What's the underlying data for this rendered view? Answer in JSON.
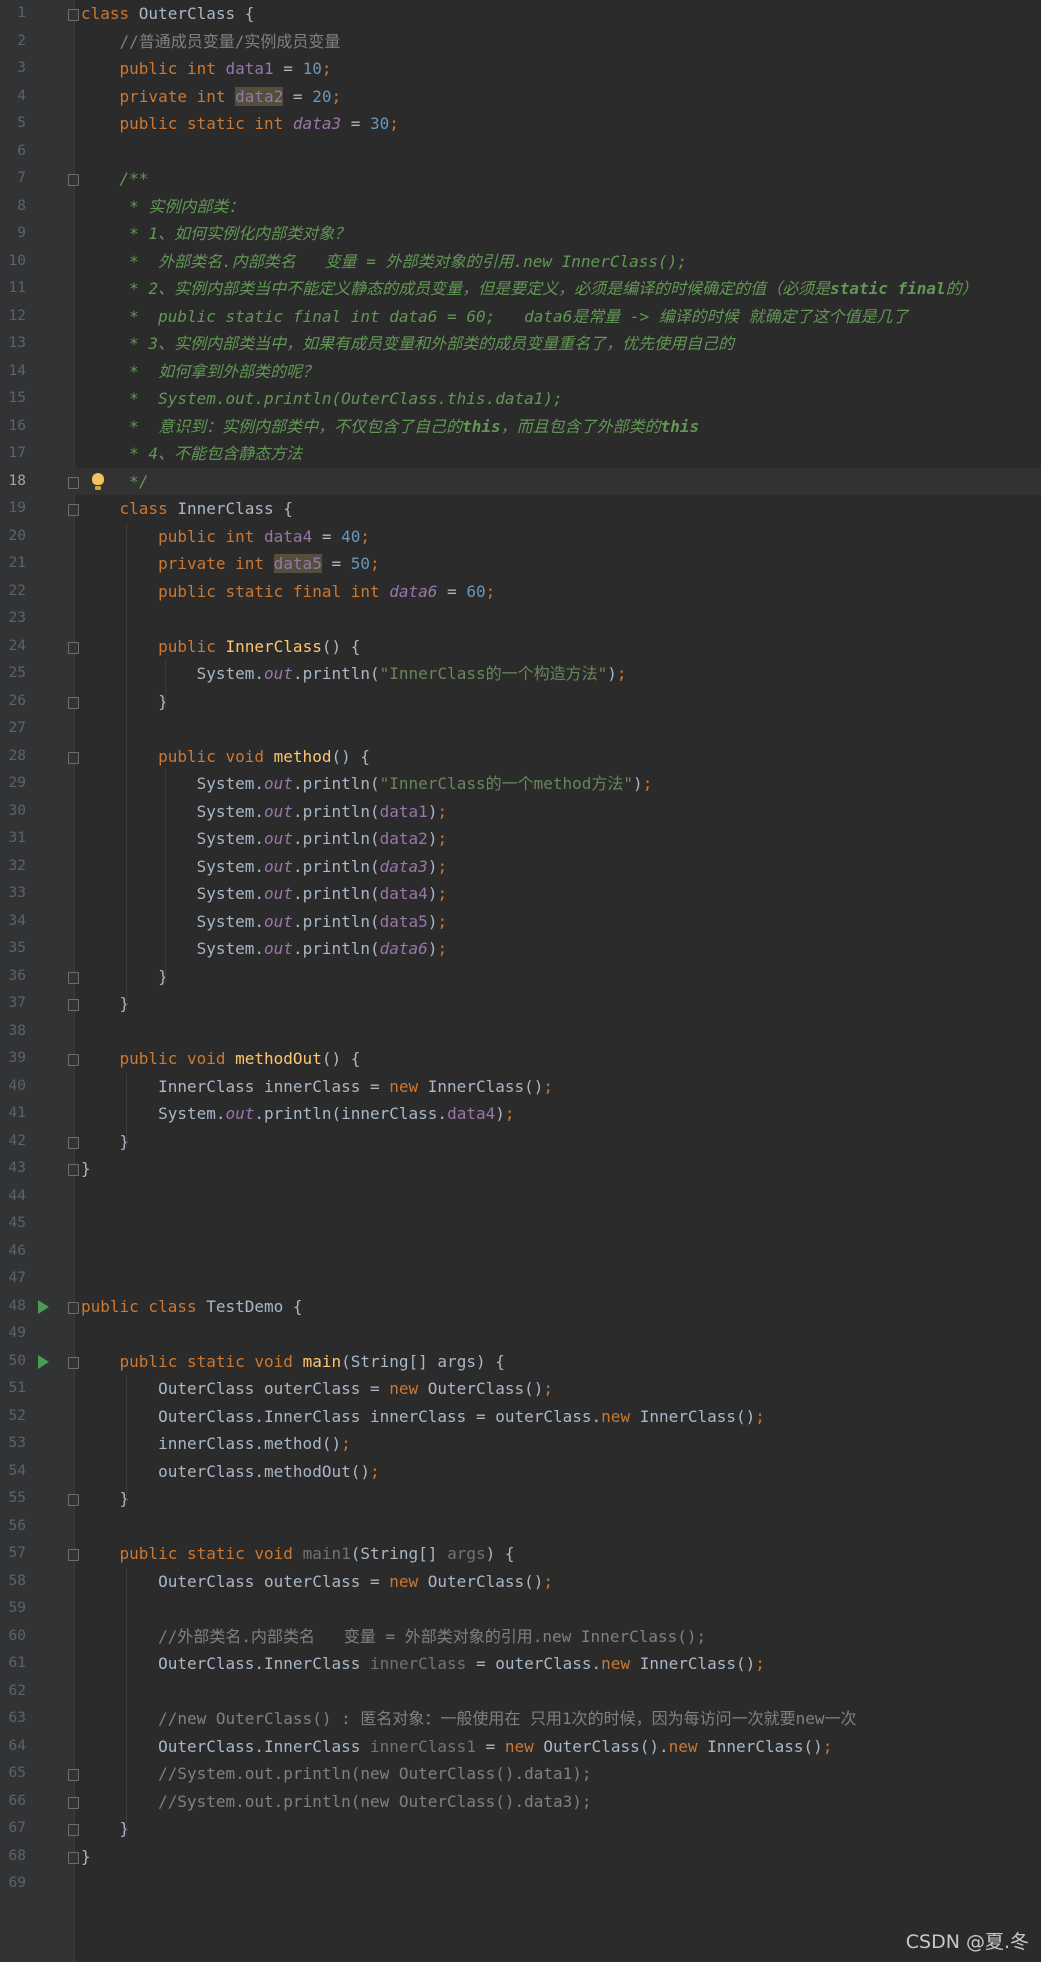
{
  "editor": {
    "current_line": 18,
    "lines": [
      [
        [
          "kw",
          "class "
        ],
        [
          "p",
          "OuterClass {"
        ]
      ],
      [
        [
          "p",
          "    "
        ],
        [
          "cmt",
          "//普通成员变量/实例成员变量"
        ]
      ],
      [
        [
          "p",
          "    "
        ],
        [
          "kw",
          "public int "
        ],
        [
          "fld",
          "data1"
        ],
        [
          "p",
          " = "
        ],
        [
          "num",
          "10"
        ],
        [
          "kw",
          ";"
        ]
      ],
      [
        [
          "p",
          "    "
        ],
        [
          "kw",
          "private int "
        ],
        [
          "fldhl",
          "data2"
        ],
        [
          "p",
          " = "
        ],
        [
          "num",
          "20"
        ],
        [
          "kw",
          ";"
        ]
      ],
      [
        [
          "p",
          "    "
        ],
        [
          "kw",
          "public static int "
        ],
        [
          "sfld",
          "data3"
        ],
        [
          "p",
          " = "
        ],
        [
          "num",
          "30"
        ],
        [
          "kw",
          ";"
        ]
      ],
      [],
      [
        [
          "p",
          "    "
        ],
        [
          "doc",
          "/**"
        ]
      ],
      [
        [
          "p",
          "    "
        ],
        [
          "doc",
          " * 实例内部类："
        ]
      ],
      [
        [
          "p",
          "    "
        ],
        [
          "doc",
          " * 1、如何实例化内部类对象？"
        ]
      ],
      [
        [
          "p",
          "    "
        ],
        [
          "doc",
          " *  外部类名.内部类名   变量 = 外部类对象的引用.new InnerClass();"
        ]
      ],
      [
        [
          "p",
          "    "
        ],
        [
          "doc",
          " * 2、实例内部类当中不能定义静态的成员变量，但是要定义，必须是编译的时候确定的值（必须是"
        ],
        [
          "dockw",
          "static final"
        ],
        [
          "doc",
          "的）"
        ]
      ],
      [
        [
          "p",
          "    "
        ],
        [
          "doc",
          " *  public static final int data6 = 60;   data6是常量 -> 编译的时候 就确定了这个值是几了"
        ]
      ],
      [
        [
          "p",
          "    "
        ],
        [
          "doc",
          " * 3、实例内部类当中，如果有成员变量和外部类的成员变量重名了，优先使用自己的"
        ]
      ],
      [
        [
          "p",
          "    "
        ],
        [
          "doc",
          " *  如何拿到外部类的呢？"
        ]
      ],
      [
        [
          "p",
          "    "
        ],
        [
          "doc",
          " *  System.out.println(OuterClass.this.data1);"
        ]
      ],
      [
        [
          "p",
          "    "
        ],
        [
          "doc",
          " *  意识到：实例内部类中，不仅包含了自己的"
        ],
        [
          "dockw",
          "this"
        ],
        [
          "doc",
          "，而且包含了外部类的"
        ],
        [
          "dockw",
          "this"
        ]
      ],
      [
        [
          "p",
          "    "
        ],
        [
          "doc",
          " * 4、不能包含静态方法"
        ]
      ],
      [
        [
          "p",
          "    "
        ],
        [
          "doc",
          " */"
        ]
      ],
      [
        [
          "p",
          "    "
        ],
        [
          "kw",
          "class "
        ],
        [
          "p",
          "InnerClass {"
        ]
      ],
      [
        [
          "p",
          "        "
        ],
        [
          "kw",
          "public int "
        ],
        [
          "fld",
          "data4"
        ],
        [
          "p",
          " = "
        ],
        [
          "num",
          "40"
        ],
        [
          "kw",
          ";"
        ]
      ],
      [
        [
          "p",
          "        "
        ],
        [
          "kw",
          "private int "
        ],
        [
          "fldhl",
          "data5"
        ],
        [
          "p",
          " = "
        ],
        [
          "num",
          "50"
        ],
        [
          "kw",
          ";"
        ]
      ],
      [
        [
          "p",
          "        "
        ],
        [
          "kw",
          "public static final int "
        ],
        [
          "sfld",
          "data6"
        ],
        [
          "p",
          " = "
        ],
        [
          "num",
          "60"
        ],
        [
          "kw",
          ";"
        ]
      ],
      [],
      [
        [
          "p",
          "        "
        ],
        [
          "kw",
          "public "
        ],
        [
          "mth",
          "InnerClass"
        ],
        [
          "p",
          "() {"
        ]
      ],
      [
        [
          "p",
          "            System."
        ],
        [
          "sfld",
          "out"
        ],
        [
          "p",
          ".println("
        ],
        [
          "str",
          "\"InnerClass的一个构造方法\""
        ],
        [
          "p",
          ")"
        ],
        [
          "kw",
          ";"
        ]
      ],
      [
        [
          "p",
          "        }"
        ]
      ],
      [],
      [
        [
          "p",
          "        "
        ],
        [
          "kw",
          "public void "
        ],
        [
          "mth",
          "method"
        ],
        [
          "p",
          "() {"
        ]
      ],
      [
        [
          "p",
          "            System."
        ],
        [
          "sfld",
          "out"
        ],
        [
          "p",
          ".println("
        ],
        [
          "str",
          "\"InnerClass的一个method方法\""
        ],
        [
          "p",
          ")"
        ],
        [
          "kw",
          ";"
        ]
      ],
      [
        [
          "p",
          "            System."
        ],
        [
          "sfld",
          "out"
        ],
        [
          "p",
          ".println("
        ],
        [
          "fld",
          "data1"
        ],
        [
          "p",
          ")"
        ],
        [
          "kw",
          ";"
        ]
      ],
      [
        [
          "p",
          "            System."
        ],
        [
          "sfld",
          "out"
        ],
        [
          "p",
          ".println("
        ],
        [
          "fld",
          "data2"
        ],
        [
          "p",
          ")"
        ],
        [
          "kw",
          ";"
        ]
      ],
      [
        [
          "p",
          "            System."
        ],
        [
          "sfld",
          "out"
        ],
        [
          "p",
          ".println("
        ],
        [
          "sfld",
          "data3"
        ],
        [
          "p",
          ")"
        ],
        [
          "kw",
          ";"
        ]
      ],
      [
        [
          "p",
          "            System."
        ],
        [
          "sfld",
          "out"
        ],
        [
          "p",
          ".println("
        ],
        [
          "fld",
          "data4"
        ],
        [
          "p",
          ")"
        ],
        [
          "kw",
          ";"
        ]
      ],
      [
        [
          "p",
          "            System."
        ],
        [
          "sfld",
          "out"
        ],
        [
          "p",
          ".println("
        ],
        [
          "fld",
          "data5"
        ],
        [
          "p",
          ")"
        ],
        [
          "kw",
          ";"
        ]
      ],
      [
        [
          "p",
          "            System."
        ],
        [
          "sfld",
          "out"
        ],
        [
          "p",
          ".println("
        ],
        [
          "sfld",
          "data6"
        ],
        [
          "p",
          ")"
        ],
        [
          "kw",
          ";"
        ]
      ],
      [
        [
          "p",
          "        }"
        ]
      ],
      [
        [
          "p",
          "    }"
        ]
      ],
      [],
      [
        [
          "p",
          "    "
        ],
        [
          "kw",
          "public void "
        ],
        [
          "mth",
          "methodOut"
        ],
        [
          "p",
          "() {"
        ]
      ],
      [
        [
          "p",
          "        InnerClass innerClass = "
        ],
        [
          "kw",
          "new "
        ],
        [
          "p",
          "InnerClass()"
        ],
        [
          "kw",
          ";"
        ]
      ],
      [
        [
          "p",
          "        System."
        ],
        [
          "sfld",
          "out"
        ],
        [
          "p",
          ".println(innerClass."
        ],
        [
          "fld",
          "data4"
        ],
        [
          "p",
          ")"
        ],
        [
          "kw",
          ";"
        ]
      ],
      [
        [
          "p",
          "    }"
        ]
      ],
      [
        [
          "p",
          "}"
        ]
      ],
      [],
      [],
      [],
      [],
      [
        [
          "kw",
          "public class "
        ],
        [
          "p",
          "TestDemo {"
        ]
      ],
      [],
      [
        [
          "p",
          "    "
        ],
        [
          "kw",
          "public static void "
        ],
        [
          "mth",
          "main"
        ],
        [
          "p",
          "(String[] args) {"
        ]
      ],
      [
        [
          "p",
          "        OuterClass outerClass = "
        ],
        [
          "kw",
          "new "
        ],
        [
          "p",
          "OuterClass()"
        ],
        [
          "kw",
          ";"
        ]
      ],
      [
        [
          "p",
          "        OuterClass.InnerClass innerClass = outerClass."
        ],
        [
          "kw",
          "new "
        ],
        [
          "p",
          "InnerClass()"
        ],
        [
          "kw",
          ";"
        ]
      ],
      [
        [
          "p",
          "        innerClass.method()"
        ],
        [
          "kw",
          ";"
        ]
      ],
      [
        [
          "p",
          "        outerClass.methodOut()"
        ],
        [
          "kw",
          ";"
        ]
      ],
      [
        [
          "p",
          "    }"
        ]
      ],
      [],
      [
        [
          "p",
          "    "
        ],
        [
          "kw",
          "public static void "
        ],
        [
          "unused",
          "main1"
        ],
        [
          "p",
          "(String[] "
        ],
        [
          "unused",
          "args"
        ],
        [
          "p",
          ") {"
        ]
      ],
      [
        [
          "p",
          "        OuterClass outerClass = "
        ],
        [
          "kw",
          "new "
        ],
        [
          "p",
          "OuterClass()"
        ],
        [
          "kw",
          ";"
        ]
      ],
      [],
      [
        [
          "p",
          "        "
        ],
        [
          "cmt",
          "//外部类名.内部类名   变量 = 外部类对象的引用.new InnerClass();"
        ]
      ],
      [
        [
          "p",
          "        OuterClass.InnerClass "
        ],
        [
          "unused",
          "innerClass"
        ],
        [
          "p",
          " = outerClass."
        ],
        [
          "kw",
          "new "
        ],
        [
          "p",
          "InnerClass()"
        ],
        [
          "kw",
          ";"
        ]
      ],
      [],
      [
        [
          "p",
          "        "
        ],
        [
          "cmt",
          "//new OuterClass() : 匿名对象：一般使用在 只用1次的时候，因为每访问一次就要new一次"
        ]
      ],
      [
        [
          "p",
          "        OuterClass.InnerClass "
        ],
        [
          "unused",
          "innerClass1"
        ],
        [
          "p",
          " = "
        ],
        [
          "kw",
          "new "
        ],
        [
          "p",
          "OuterClass()."
        ],
        [
          "kw",
          "new "
        ],
        [
          "p",
          "InnerClass()"
        ],
        [
          "kw",
          ";"
        ]
      ],
      [
        [
          "p",
          "        "
        ],
        [
          "cmt",
          "//System.out.println(new OuterClass().data1);"
        ]
      ],
      [
        [
          "p",
          "        "
        ],
        [
          "cmt",
          "//System.out.println(new OuterClass().data3);"
        ]
      ],
      [
        [
          "p",
          "    }"
        ]
      ],
      [
        [
          "p",
          "}"
        ]
      ],
      []
    ]
  },
  "gutter": {
    "run_icon": "run-arrow-icon",
    "fold_icon": "fold-marker-icon",
    "bulb_icon": "intention-bulb-icon",
    "run_lines": [
      48,
      50
    ],
    "bulb_lines": [
      18
    ],
    "fold_lines": [
      1,
      7,
      18,
      19,
      24,
      26,
      28,
      36,
      37,
      39,
      42,
      43,
      48,
      50,
      55,
      57,
      65,
      66,
      67,
      68
    ]
  },
  "watermark": "CSDN @夏.冬"
}
